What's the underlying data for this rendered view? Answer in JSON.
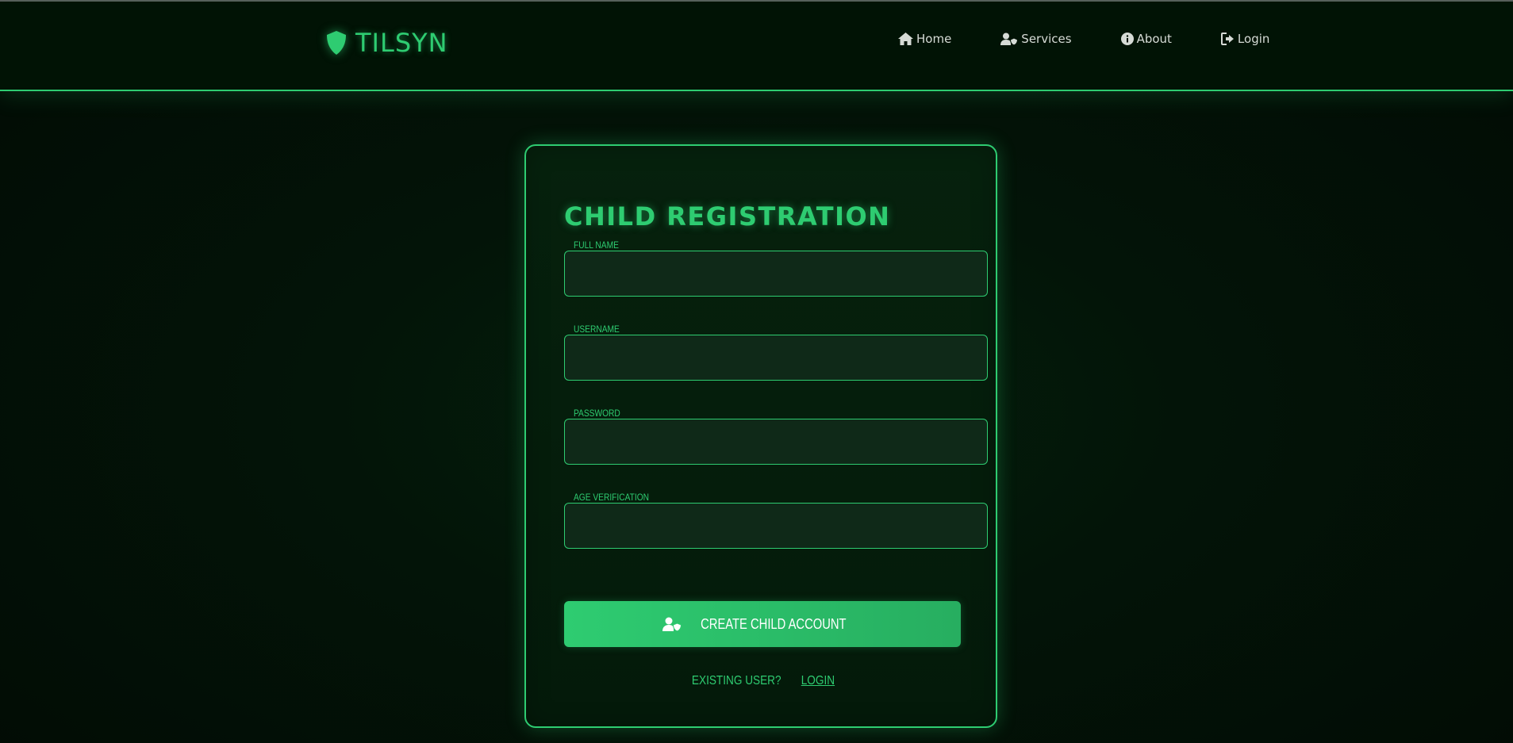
{
  "header": {
    "brand": "TILSYN",
    "nav": [
      {
        "label": "Home",
        "icon": "home-icon"
      },
      {
        "label": "Services",
        "icon": "user-shield-icon"
      },
      {
        "label": "About",
        "icon": "info-circle-icon"
      },
      {
        "label": "Login",
        "icon": "sign-in-icon"
      }
    ]
  },
  "form": {
    "title": "CHILD REGISTRATION",
    "fields": [
      {
        "label": "FULL NAME",
        "value": "",
        "placeholder": ""
      },
      {
        "label": "USERNAME",
        "value": "",
        "placeholder": ""
      },
      {
        "label": "PASSWORD",
        "value": "",
        "placeholder": ""
      },
      {
        "label": "AGE VERIFICATION",
        "value": "",
        "placeholder": ""
      }
    ],
    "submit_label": "CREATE CHILD ACCOUNT",
    "existing_user": "EXISTING USER?",
    "login_link": "LOGIN"
  },
  "colors": {
    "accent": "#2ecc71",
    "background": "#020d05",
    "navbar": "#011305",
    "input_bg": "#0f2918"
  }
}
